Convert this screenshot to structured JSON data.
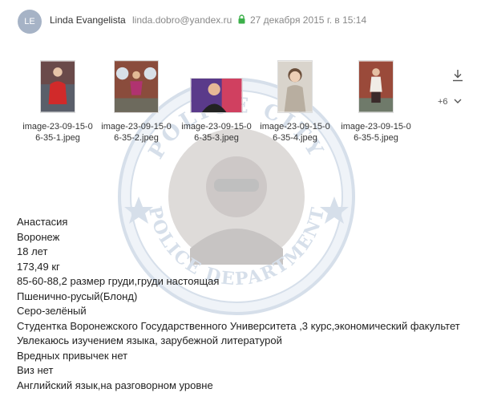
{
  "header": {
    "avatar_initials": "LE",
    "sender_name": "Linda Evangelista",
    "sender_email": "linda.dobro@yandex.ru",
    "date": "27 декабря 2015 г. в 15:14"
  },
  "attachments": [
    {
      "name": "image-23-09-15-06-35-1.jpeg"
    },
    {
      "name": "image-23-09-15-06-35-2.jpeg"
    },
    {
      "name": "image-23-09-15-06-35-3.jpeg"
    },
    {
      "name": "image-23-09-15-06-35-4.jpeg"
    },
    {
      "name": "image-23-09-15-06-35-5.jpeg"
    }
  ],
  "attachments_more": "+6",
  "watermark": {
    "top_text": "POLICE CITY",
    "bottom_text": "POLICE DEPARTMENT"
  },
  "body": [
    "Анастасия",
    "Воронеж",
    "18 лет",
    "173,49 кг",
    "85-60-88,2 размер груди,груди настоящая",
    "Пшенично-русый(Блонд)",
    "Серо-зелёный",
    "Студентка Воронежского Государственного Университета ,3 курс,экономический факультет",
    "Увлекаюсь изучением языка, зарубежной литературой",
    "Вредных привычек нет",
    "Виз нет",
    "Английский язык,на разговорном уровне"
  ],
  "colors": {
    "lock": "#3cb04a",
    "avatar": "#a6b3c6",
    "muted_text": "#888888"
  }
}
